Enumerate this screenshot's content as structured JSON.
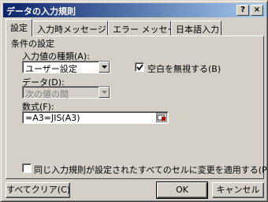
{
  "window": {
    "title": "データの入力規則",
    "help_label": "?",
    "close_label": "×"
  },
  "tabs": [
    {
      "label": "設定"
    },
    {
      "label": "入力時メッセージ"
    },
    {
      "label": "エラー メッセージ"
    },
    {
      "label": "日本語入力"
    }
  ],
  "settings": {
    "group_label": "条件の設定",
    "allow_label": "入力値の種類(A):",
    "allow_value": "ユーザー設定",
    "ignore_blank_label": "空白を無視する(B)",
    "ignore_blank_checked": true,
    "data_label": "データ(D):",
    "data_value": "次の値の間",
    "formula_label": "数式(F):",
    "formula_value": "=A3=JIS(A3)",
    "apply_all_label": "同じ入力規則が設定されたすべてのセルに変更を適用する(P)",
    "apply_all_checked": false
  },
  "buttons": {
    "clear_all": "すべてクリア(C)",
    "ok": "OK",
    "cancel": "キャンセル"
  },
  "icons": {
    "dropdown_arrow": "chevron-down-icon",
    "check": "checkmark-icon",
    "collapse": "collapse-dialog-icon"
  }
}
